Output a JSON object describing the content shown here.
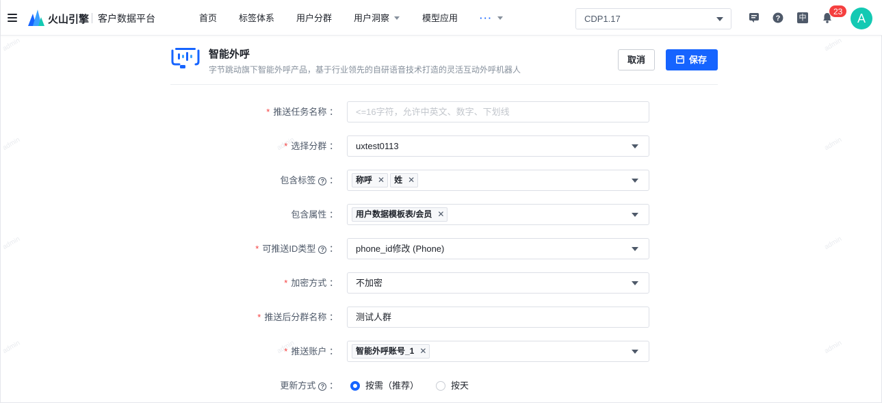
{
  "topbar": {
    "brand": "火山引擎",
    "product": "客户数据平台",
    "nav": [
      {
        "label": "首页",
        "dropdown": false
      },
      {
        "label": "标签体系",
        "dropdown": false
      },
      {
        "label": "用户分群",
        "dropdown": false
      },
      {
        "label": "用户洞察",
        "dropdown": true
      },
      {
        "label": "模型应用",
        "dropdown": false
      },
      {
        "label": "···",
        "dropdown": true
      }
    ],
    "version": "CDP1.17",
    "language": "中",
    "notification_count": "23",
    "avatar_letter": "A",
    "icons": [
      "menu-icon",
      "feedback-icon",
      "help-icon",
      "language-icon",
      "bell-icon"
    ]
  },
  "watermark": "admin",
  "header": {
    "title": "智能外呼",
    "description": "字节跳动旗下智能外呼产品，基于行业领先的自研语音技术打造的灵活互动外呼机器人",
    "cancel_label": "取消",
    "save_label": "保存"
  },
  "form": {
    "task_name": {
      "label": "推送任务名称",
      "required": true,
      "placeholder": "<=16字符，允许中英文、数字、下划线",
      "value": ""
    },
    "segment": {
      "label": "选择分群",
      "required": true,
      "value": "uxtest0113"
    },
    "tags": {
      "label": "包含标签",
      "required": false,
      "values": [
        "称呼",
        "姓"
      ]
    },
    "attributes": {
      "label": "包含属性",
      "required": false,
      "values": [
        "用户数据模板表/会员"
      ]
    },
    "id_type": {
      "label": "可推送ID类型",
      "required": true,
      "value": "phone_id修改 (Phone)"
    },
    "encryption": {
      "label": "加密方式",
      "required": true,
      "value": "不加密"
    },
    "segment_name": {
      "label": "推送后分群名称",
      "required": true,
      "value": "测试人群"
    },
    "account": {
      "label": "推送账户",
      "required": true,
      "values": [
        "智能外呼账号_1"
      ]
    },
    "update_mode": {
      "label": "更新方式",
      "required": false,
      "options": [
        "按需（推荐）",
        "按天"
      ],
      "selected": "按需（推荐）"
    }
  },
  "colors": {
    "primary": "#1664ff",
    "danger": "#f53f3f",
    "avatar": "#14c9b3"
  }
}
